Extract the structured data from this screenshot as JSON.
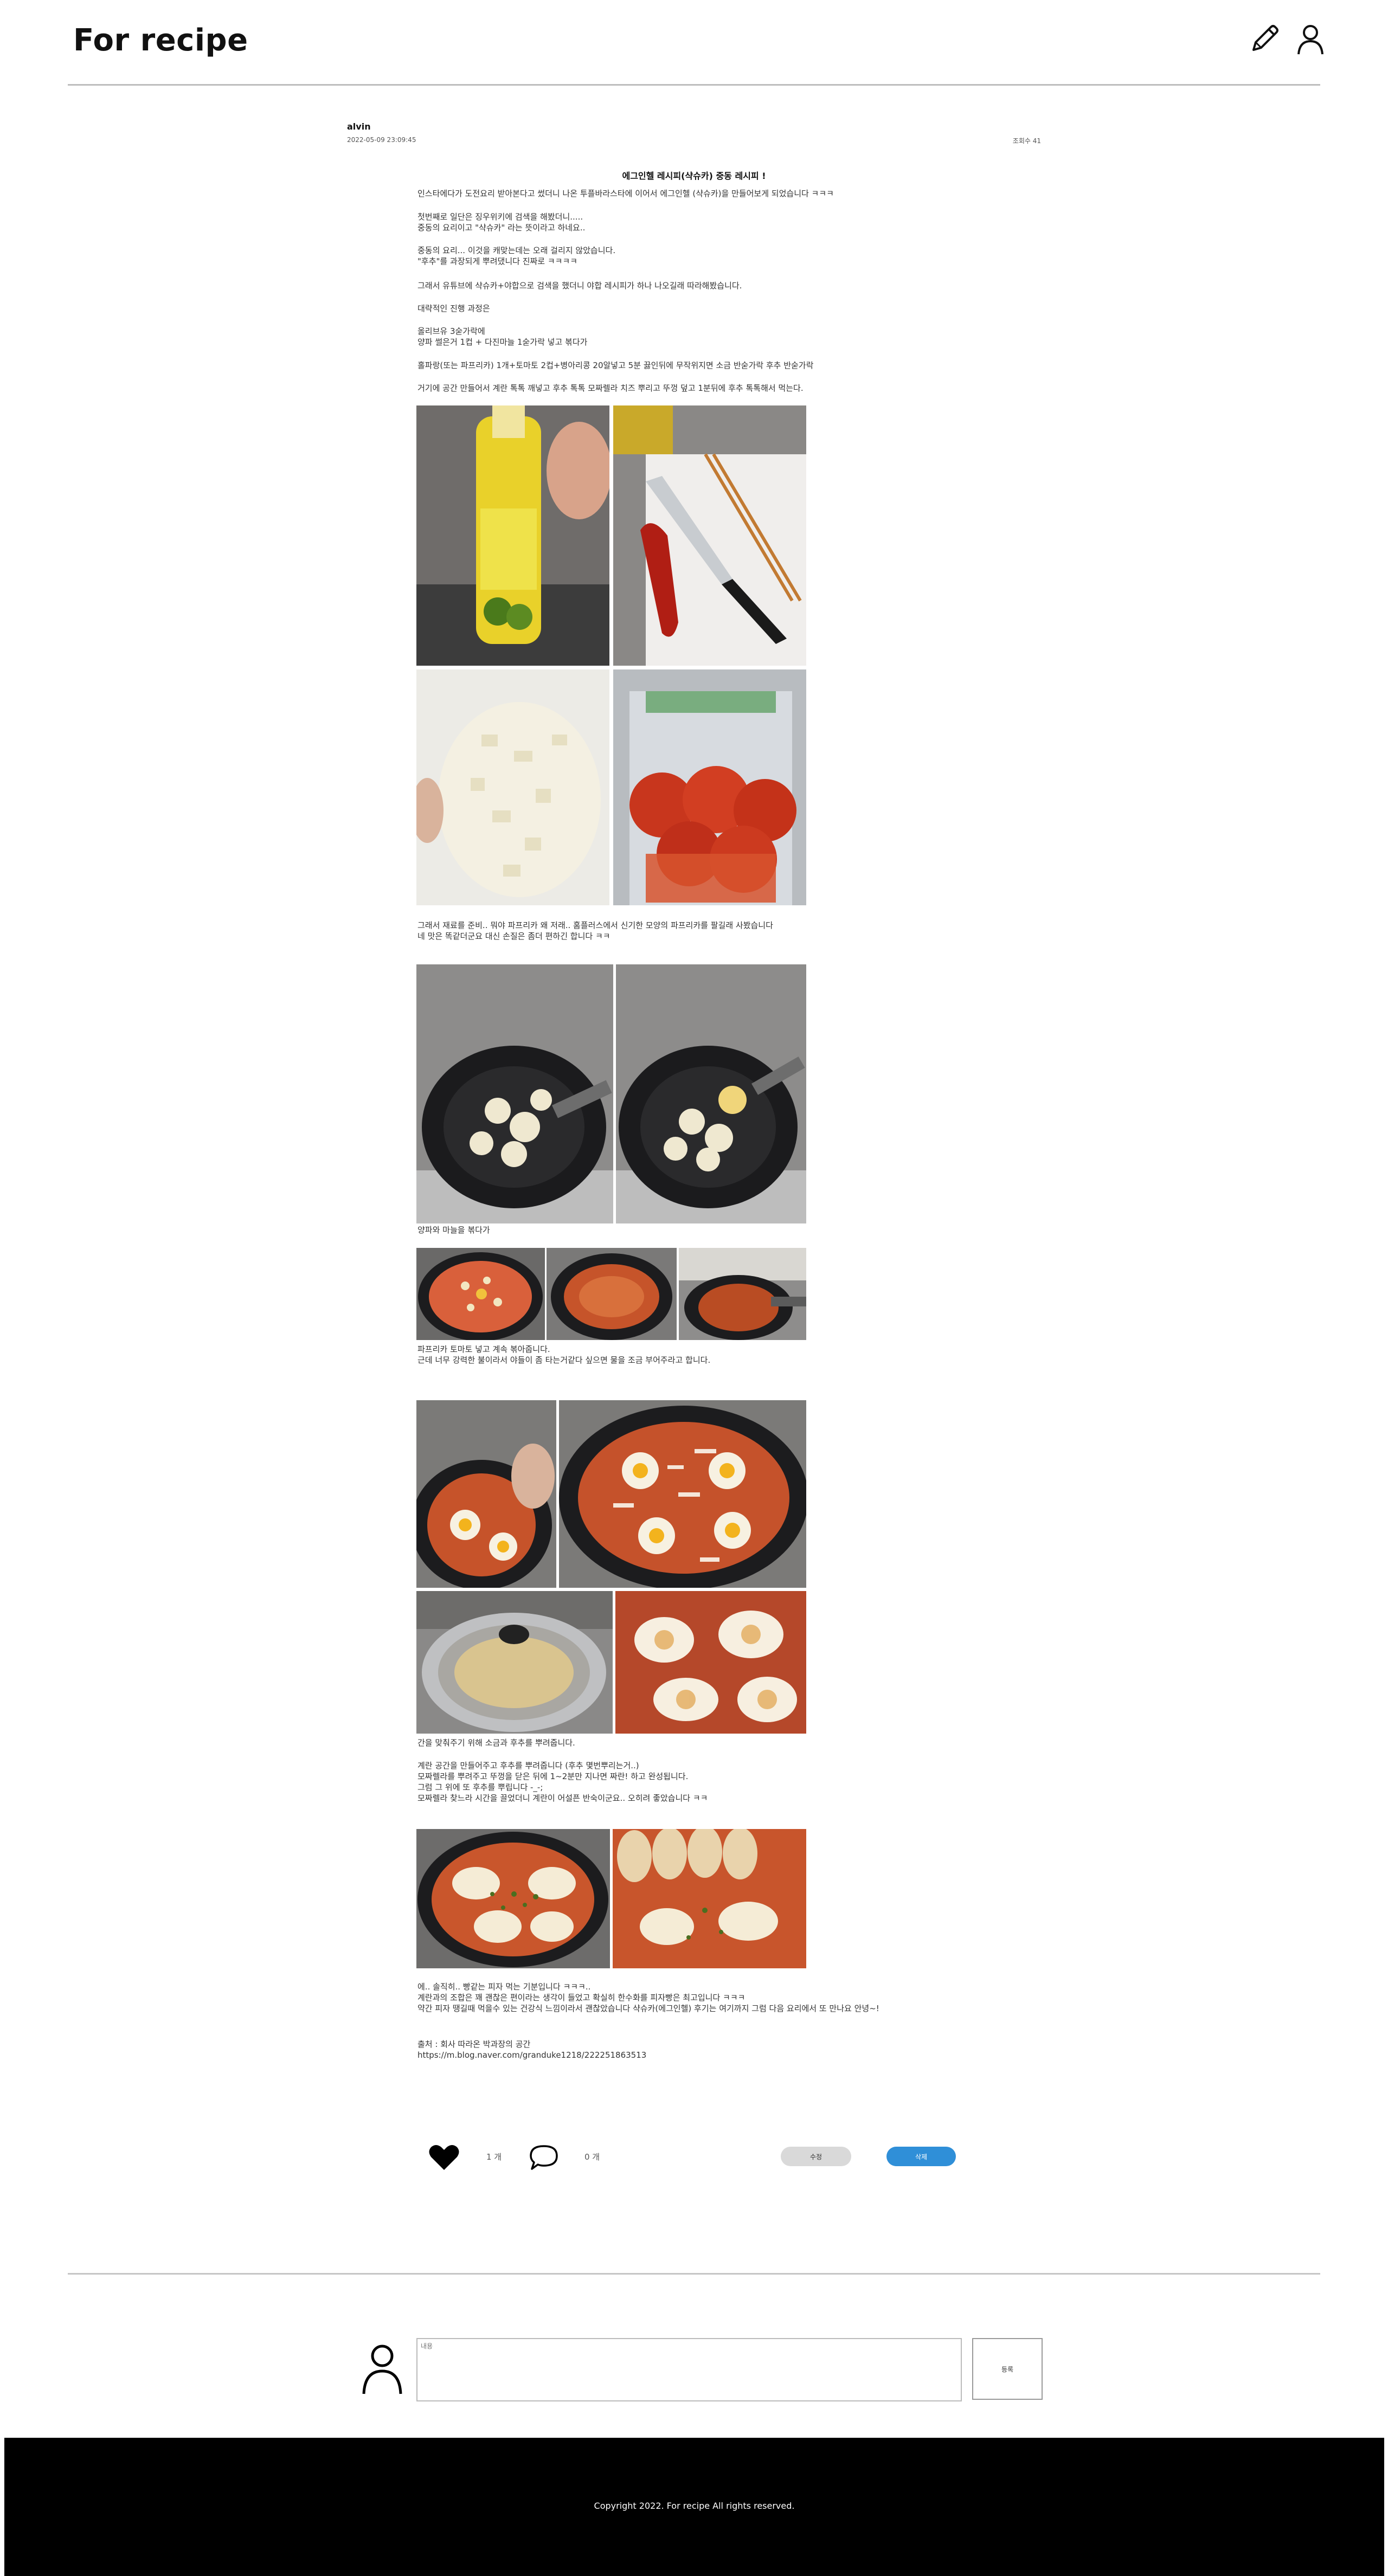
{
  "header": {
    "brand": "For recipe",
    "write_icon": "pencil-icon",
    "user_icon": "user-icon"
  },
  "post": {
    "author": "alvin",
    "date": "2022-05-09 23:09:45",
    "views": "조회수 41",
    "title": "에그인헬 레시피(샥슈카) 중동 레시피 !",
    "paragraphs": [
      "인스타에다가 도전요리 받아본다고 썼더니 나온 투플바라스타에 이어서 에그인헬 (샥슈카)을 만들어보게 되었습니다 ㅋㅋㅋ",
      "첫번째로 일단은 징우위키에 검색을 해봤더니.....\n중동의 요리이고 \"샥슈카\" 라는 뜻이라고 하네요..",
      "중동의 요리... 이것을 캐맞는데는 오래 걸리지 않았습니다.\n\"후추\"를 과장되게 뿌려댔니다 진짜로 ㅋㅋㅋㅋ",
      "그래서 유튜브에 샥슈카+야합으로 검색을 했더니 야합 레시피가 하나 나오길래 따라해봤습니다.",
      "대략적인 진행 과정은",
      "올리브유 3숟가락에\n양파 썰은거 1컵 + 다진마늘 1숟가락 넣고 볶다가",
      "홀파랑(또는 파프리카) 1개+토마토 2컵+병아리콩 20알넣고 5분 끓인뒤에 무작위지면 소금 반숟가락 후추 반숟가락",
      "거기에 공간 만들어서 계란 톡톡 깨넣고 후추 톡톡 모짜렐라 치즈 뿌리고 뚜껑 덮고 1분뒤에 후추 톡톡해서 먹는다.",
      "그래서 재료를 준비.. 뭐야 파프리카 왜 저래.. 홈플러스에서 신기한 모양의 파프리카를 팔길래 사봤습니다\n네 맛은 똑같더군요 대신 손질은 좀더 편하긴 합니다 ㅋㅋ",
      "양파와 마늘을 볶다가",
      "파프리카 토마토 넣고 계속 볶아줍니다.\n근데 너무 강력한 불이라서 야들이 좀 타는거같다 싶으면 물을 조금 부어주라고 합니다.",
      "간을 맞춰주기 위해 소금과 후추를 뿌려줍니다.",
      "계란 공간을 만들어주고 후추를 뿌려줍니다 (후추 몇번뿌리는거..)\n모짜렐라를 뿌려주고 뚜껑을 닫은 뒤에 1~2분만 지나면 짜란! 하고 완성됩니다.\n그럼 그 위에 또 후추를 뿌립니다 -_-;\n모짜렐라 찾느라 시간을 끌었더니 계란이 어설픈 반숙이군요.. 오히려 좋았습니다 ㅋㅋ",
      "에.. 솔직히.. 빵같는 피자 먹는 기분입니다 ㅋㅋㅋ..\n계란과의 조합은 꽤 괜찮은 편이라는 생각이 들었고 확실히 한수화를 피자빵은 최고입니다 ㅋㅋㅋ\n약간 피자 땡길때 먹을수 있는 건강식 느낌이라서 괜찮았습니다 샥슈카(에그인헬) 후기는 여기까지 그럼 다음 요리에서 또 만나요 안녕~!",
      "출처 : 회사 따라온 박과장의 공간\nhttps://m.blog.naver.com/granduke1218/222251863513"
    ],
    "photos": [
      {
        "name": "olive-oil-photo"
      },
      {
        "name": "pepper-knife-photo"
      },
      {
        "name": "chopped-onion-photo"
      },
      {
        "name": "tomato-bag-photo"
      },
      {
        "name": "pan-onion-photo"
      },
      {
        "name": "pan-onion-garlic-photo"
      },
      {
        "name": "pan-tomato-photo"
      },
      {
        "name": "pan-sauce-photo"
      },
      {
        "name": "pan-sauce-2-photo"
      },
      {
        "name": "pan-eggs-hand-photo"
      },
      {
        "name": "pan-eggs-cheese-photo"
      },
      {
        "name": "pan-lid-photo"
      },
      {
        "name": "pan-melted-cheese-photo"
      },
      {
        "name": "shakshuka-herbs-photo"
      },
      {
        "name": "shakshuka-bread-photo"
      }
    ]
  },
  "actions": {
    "like_icon": "heart-icon",
    "like_count": "1 개",
    "comment_icon": "speech-bubble-icon",
    "comment_count": "0 개",
    "edit_label": "수정",
    "delete_label": "삭제",
    "delete_color": "#2f8fd8"
  },
  "comment_form": {
    "avatar_icon": "user-icon",
    "placeholder": "내용",
    "submit_label": "등록"
  },
  "footer": {
    "copyright": "Copyright 2022. For recipe All rights reserved."
  }
}
